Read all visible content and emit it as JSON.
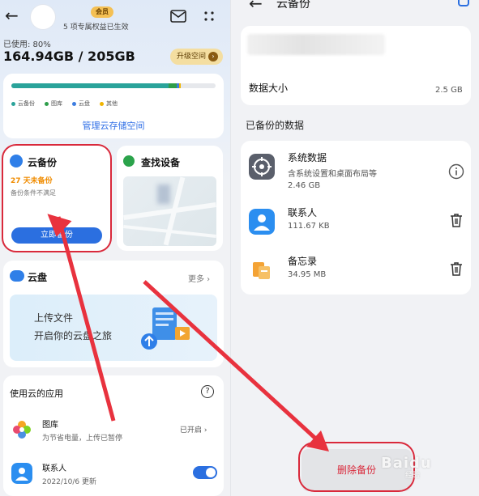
{
  "left": {
    "header": {
      "vip_badge": "会员",
      "benefit_text": "5 项专属权益已生效"
    },
    "storage": {
      "used_label": "已使用: 80%",
      "used_value": "164.94GB / 205GB",
      "used_fraction": 0.8,
      "upgrade_label": "升级空间",
      "legend": [
        "云备份",
        "图库",
        "云盘",
        "其他"
      ],
      "legend_colors": [
        "#2aa39a",
        "#2e9e4a",
        "#3d7de0",
        "#f0b400"
      ],
      "manage_label": "管理云存储空间"
    },
    "backup_card": {
      "title": "云备份",
      "warning": "27 天未备份",
      "subtitle": "备份条件不满足",
      "button_label": "立即备份"
    },
    "find_card": {
      "title": "查找设备"
    },
    "drive_card": {
      "title": "云盘",
      "more_label": "更多",
      "banner_line1": "上传文件",
      "banner_line2": "开启你的云盘之旅"
    },
    "apps_card": {
      "title": "使用云的应用",
      "apps": [
        {
          "name": "图库",
          "sub": "为节省电量，上传已暂停",
          "status": "已开启"
        },
        {
          "name": "联系人",
          "sub": "2022/10/6 更新",
          "toggle_on": true
        }
      ]
    }
  },
  "right": {
    "title": "云备份",
    "data_size_label": "数据大小",
    "data_size_value": "2.5 GB",
    "backed_label": "已备份的数据",
    "items": [
      {
        "name": "系统数据",
        "desc": "含系统设置和桌面布局等",
        "size": "2.46 GB",
        "action": "info-icon"
      },
      {
        "name": "联系人",
        "size": "111.67 KB",
        "action": "trash-icon"
      },
      {
        "name": "备忘录",
        "size": "34.95 MB",
        "action": "trash-icon"
      }
    ],
    "delete_label": "删除备份"
  },
  "watermark": {
    "brand": "Baidu",
    "sub": "经验"
  },
  "colors": {
    "accent": "#2b6fe0",
    "warning": "#f08c00",
    "annotation_red": "#d9293b"
  }
}
